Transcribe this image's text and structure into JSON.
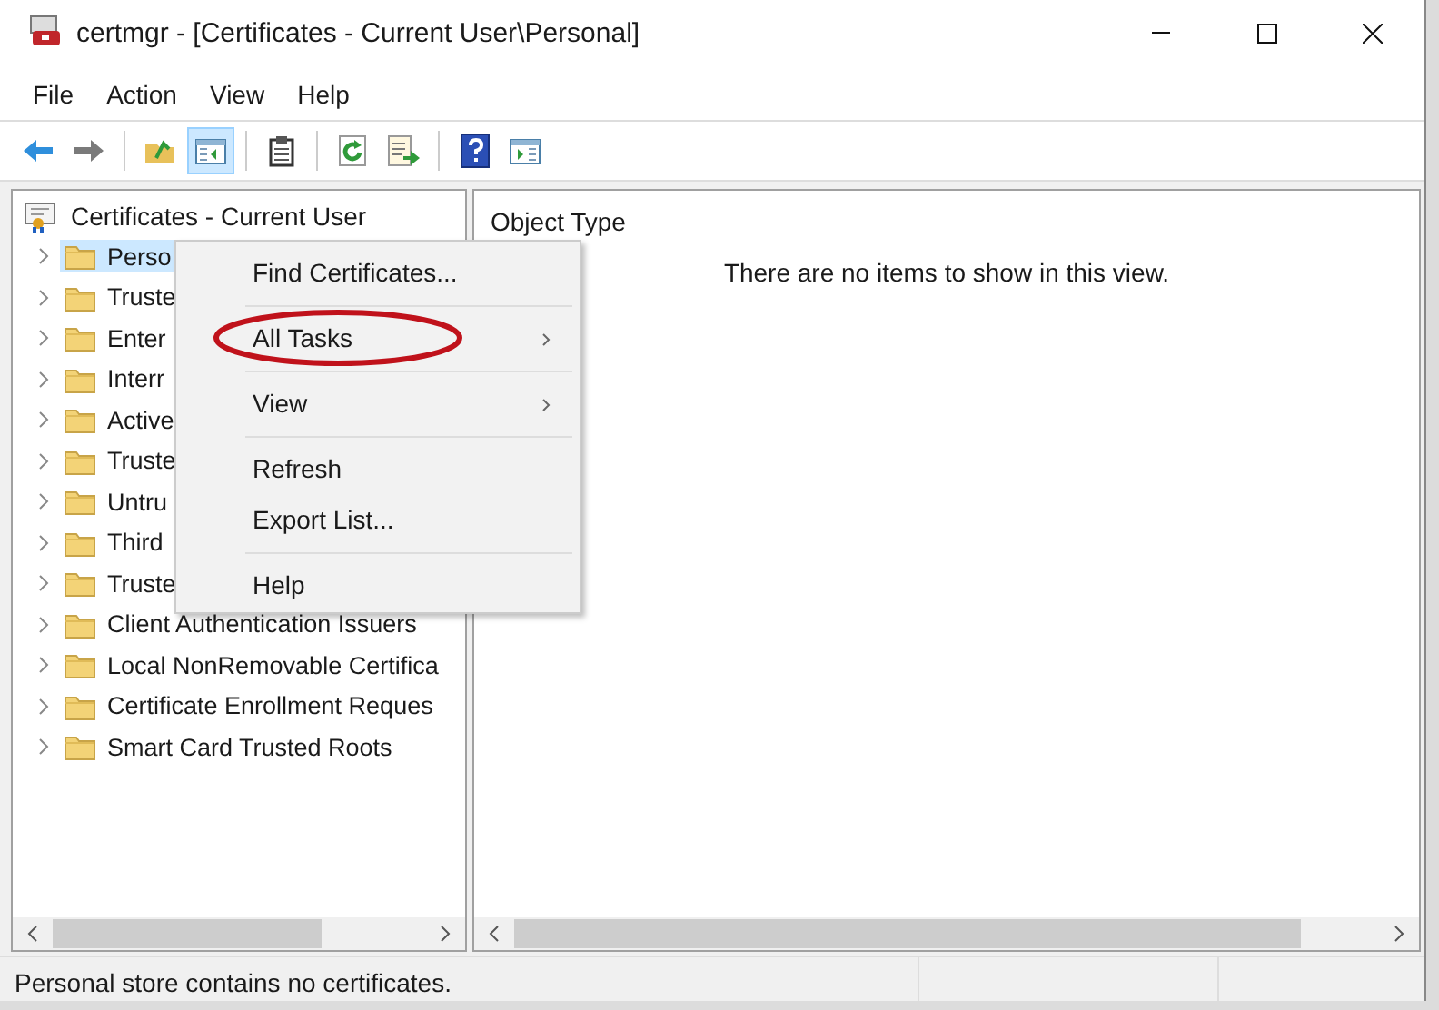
{
  "window": {
    "title": "certmgr - [Certificates - Current User\\Personal]"
  },
  "menu_bar": [
    "File",
    "Action",
    "View",
    "Help"
  ],
  "toolbar": [
    {
      "kind": "back",
      "pressed": false
    },
    {
      "kind": "forward",
      "pressed": false
    },
    {
      "kind": "separator"
    },
    {
      "kind": "up",
      "pressed": false
    },
    {
      "kind": "tree-toggle",
      "pressed": true
    },
    {
      "kind": "separator"
    },
    {
      "kind": "properties",
      "pressed": false
    },
    {
      "kind": "separator"
    },
    {
      "kind": "refresh",
      "pressed": false
    },
    {
      "kind": "export",
      "pressed": false
    },
    {
      "kind": "separator"
    },
    {
      "kind": "help",
      "pressed": false
    },
    {
      "kind": "action-pane",
      "pressed": false
    }
  ],
  "tree": {
    "root": "Certificates - Current User",
    "items": [
      {
        "label": "Perso",
        "selected": true
      },
      {
        "label": "Truste",
        "selected": false
      },
      {
        "label": "Enter",
        "selected": false
      },
      {
        "label": "Interr",
        "selected": false
      },
      {
        "label": "Active",
        "selected": false
      },
      {
        "label": "Truste",
        "selected": false
      },
      {
        "label": "Untru",
        "selected": false
      },
      {
        "label": "Third",
        "selected": false
      },
      {
        "label": "Truste",
        "selected": false
      },
      {
        "label": "Client Authentication Issuers",
        "selected": false
      },
      {
        "label": "Local NonRemovable Certifica",
        "selected": false
      },
      {
        "label": "Certificate Enrollment Reques",
        "selected": false
      },
      {
        "label": "Smart Card Trusted Roots",
        "selected": false
      }
    ]
  },
  "list": {
    "columns": [
      "Object Type"
    ],
    "empty_message": "There are no items to show in this view."
  },
  "context_menu": {
    "items": [
      {
        "kind": "item",
        "label": "Find Certificates...",
        "submenu": false,
        "circled": false
      },
      {
        "kind": "separator"
      },
      {
        "kind": "item",
        "label": "All Tasks",
        "submenu": true,
        "circled": true
      },
      {
        "kind": "separator"
      },
      {
        "kind": "item",
        "label": "View",
        "submenu": true,
        "circled": false
      },
      {
        "kind": "separator"
      },
      {
        "kind": "item",
        "label": "Refresh",
        "submenu": false,
        "circled": false
      },
      {
        "kind": "item",
        "label": "Export List...",
        "submenu": false,
        "circled": false
      },
      {
        "kind": "separator"
      },
      {
        "kind": "item",
        "label": "Help",
        "submenu": false,
        "circled": false
      }
    ]
  },
  "status_bar": "Personal store contains no certificates."
}
